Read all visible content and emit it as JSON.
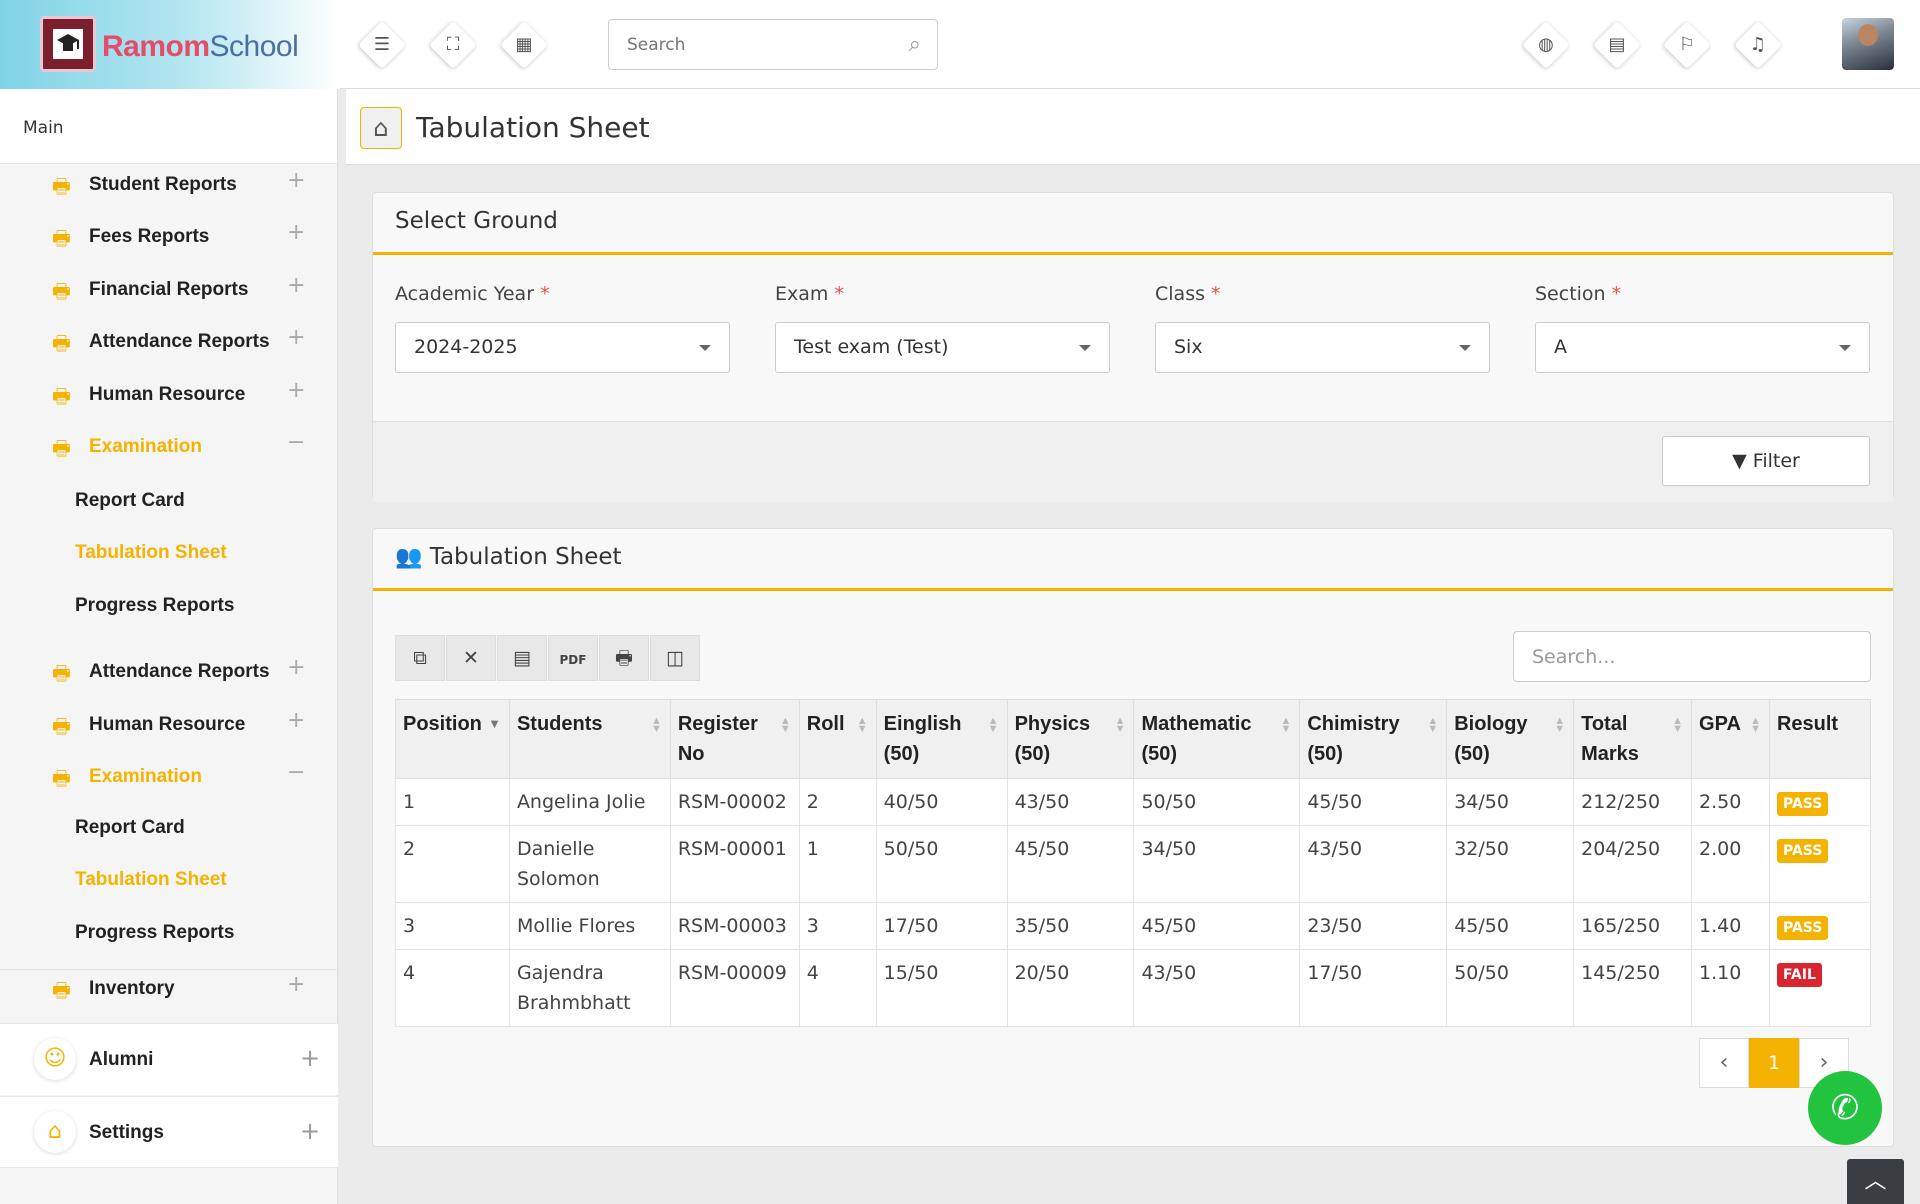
{
  "brand": {
    "part1": "Ramom",
    "part2": "School"
  },
  "topbar": {
    "search_placeholder": "Search",
    "icons": [
      "menu-icon",
      "fullscreen-icon",
      "grid-icon",
      "globe-icon",
      "calendar-icon",
      "flag-icon",
      "bell-icon"
    ]
  },
  "sidebar": {
    "main_label": "Main",
    "items": [
      {
        "label": "Student Reports"
      },
      {
        "label": "Fees Reports"
      },
      {
        "label": "Financial Reports"
      },
      {
        "label": "Attendance Reports"
      },
      {
        "label": "Human Resource"
      },
      {
        "label": "Examination"
      },
      {
        "label": "Attendance Reports"
      },
      {
        "label": "Human Resource"
      },
      {
        "label": "Examination"
      },
      {
        "label": "Inventory"
      }
    ],
    "sub_items": [
      "Report Card",
      "Tabulation Sheet",
      "Progress Reports",
      "Report Card",
      "Tabulation Sheet",
      "Progress Reports"
    ],
    "alumni": "Alumni",
    "settings": "Settings"
  },
  "page": {
    "title": "Tabulation Sheet"
  },
  "select_panel": {
    "heading": "Select Ground",
    "fields": [
      {
        "label": "Academic Year",
        "value": "2024-2025"
      },
      {
        "label": "Exam",
        "value": "Test exam (Test)"
      },
      {
        "label": "Class",
        "value": "Six"
      },
      {
        "label": "Section",
        "value": "A"
      }
    ],
    "required_mark": "*",
    "filter_label": "Filter"
  },
  "sheet_panel": {
    "heading": "Tabulation Sheet",
    "search_placeholder": "Search...",
    "columns": [
      {
        "line1": "Position",
        "line2": ""
      },
      {
        "line1": "Students",
        "line2": ""
      },
      {
        "line1": "Register",
        "line2": "No"
      },
      {
        "line1": "Roll",
        "line2": ""
      },
      {
        "line1": "Einglish",
        "line2": "(50)"
      },
      {
        "line1": "Physics",
        "line2": "(50)"
      },
      {
        "line1": "Mathematic",
        "line2": "(50)"
      },
      {
        "line1": "Chimistry",
        "line2": "(50)"
      },
      {
        "line1": "Biology",
        "line2": "(50)"
      },
      {
        "line1": "Total",
        "line2": "Marks"
      },
      {
        "line1": "GPA",
        "line2": ""
      },
      {
        "line1": "Result",
        "line2": ""
      }
    ],
    "rows": [
      {
        "pos": "1",
        "name1": "Angelina Jolie",
        "name2": "",
        "reg": "RSM-00002",
        "roll": "2",
        "eng": "40/50",
        "phy": "43/50",
        "math": "50/50",
        "chem": "45/50",
        "bio": "34/50",
        "total": "212/250",
        "gpa": "2.50",
        "result": "PASS"
      },
      {
        "pos": "2",
        "name1": "Danielle",
        "name2": "Solomon",
        "reg": "RSM-00001",
        "roll": "1",
        "eng": "50/50",
        "phy": "45/50",
        "math": "34/50",
        "chem": "43/50",
        "bio": "32/50",
        "total": "204/250",
        "gpa": "2.00",
        "result": "PASS"
      },
      {
        "pos": "3",
        "name1": "Mollie Flores",
        "name2": "",
        "reg": "RSM-00003",
        "roll": "3",
        "eng": "17/50",
        "phy": "35/50",
        "math": "45/50",
        "chem": "23/50",
        "bio": "45/50",
        "total": "165/250",
        "gpa": "1.40",
        "result": "PASS"
      },
      {
        "pos": "4",
        "name1": "Gajendra",
        "name2": "Brahmbhatt",
        "reg": "RSM-00009",
        "roll": "4",
        "eng": "15/50",
        "phy": "20/50",
        "math": "43/50",
        "chem": "17/50",
        "bio": "50/50",
        "total": "145/250",
        "gpa": "1.10",
        "result": "FAIL"
      }
    ],
    "pager": {
      "current": "1"
    }
  },
  "colors": {
    "accent": "#f5b301",
    "fail": "#d9262e",
    "whatsapp": "#22c33f"
  }
}
